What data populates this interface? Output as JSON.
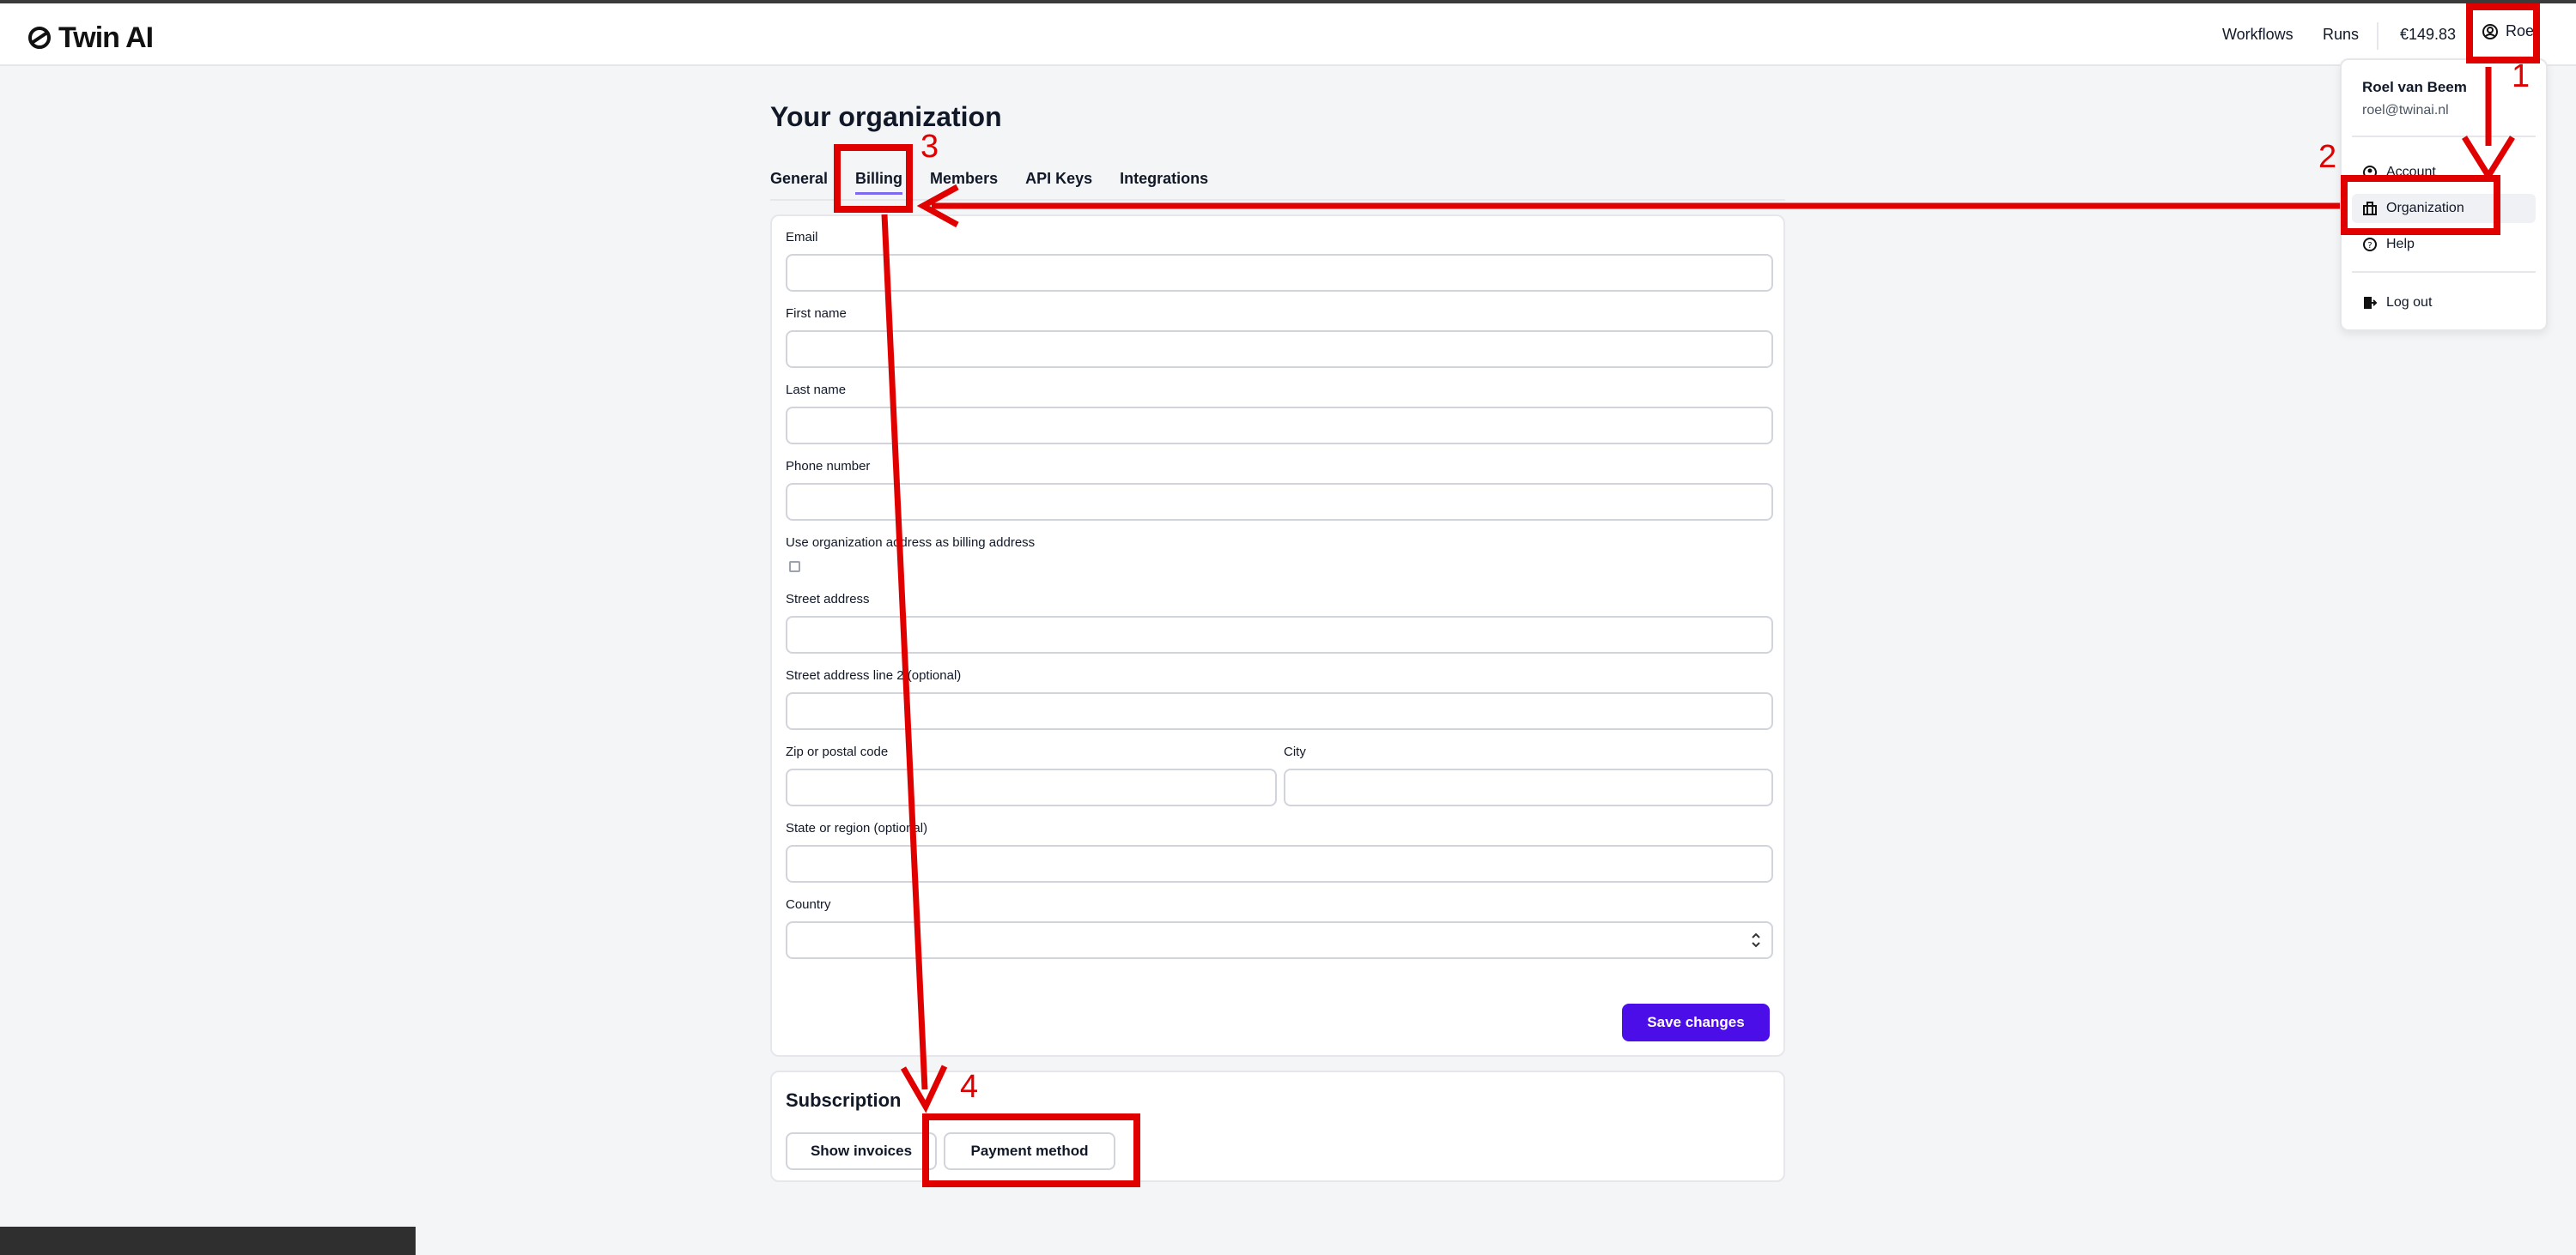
{
  "topbar": {
    "logo_text": "Twin AI",
    "nav": [
      "Workflows",
      "Runs"
    ],
    "credits": "€149.83",
    "user_label": "Roel"
  },
  "page": {
    "title": "Your organization",
    "tabs": [
      "General",
      "Billing",
      "Members",
      "API Keys",
      "Integrations"
    ],
    "active_tab": "Billing"
  },
  "billing_form": {
    "email_label": "Email",
    "first_name_label": "First name",
    "last_name_label": "Last name",
    "phone_label": "Phone number",
    "use_org_address_label": "Use organization address as billing address",
    "use_org_address_checked": false,
    "street_label": "Street address",
    "street2_label": "Street address line 2 (optional)",
    "zip_label": "Zip or postal code",
    "city_label": "City",
    "state_label": "State or region (optional)",
    "country_label": "Country",
    "save_label": "Save changes"
  },
  "subscription": {
    "title": "Subscription",
    "show_invoices_label": "Show invoices",
    "payment_method_label": "Payment method"
  },
  "user_menu": {
    "name": "Roel van Beem",
    "email": "roel@twinai.nl",
    "items": [
      "Account",
      "Organization",
      "Help",
      "Log out"
    ],
    "active_item": "Organization"
  },
  "annotations": {
    "steps": [
      "1",
      "2",
      "3",
      "4"
    ],
    "color": "#e10000"
  },
  "colors": {
    "primary": "#4b0ee8",
    "tab_underline": "#7c6bf0"
  }
}
